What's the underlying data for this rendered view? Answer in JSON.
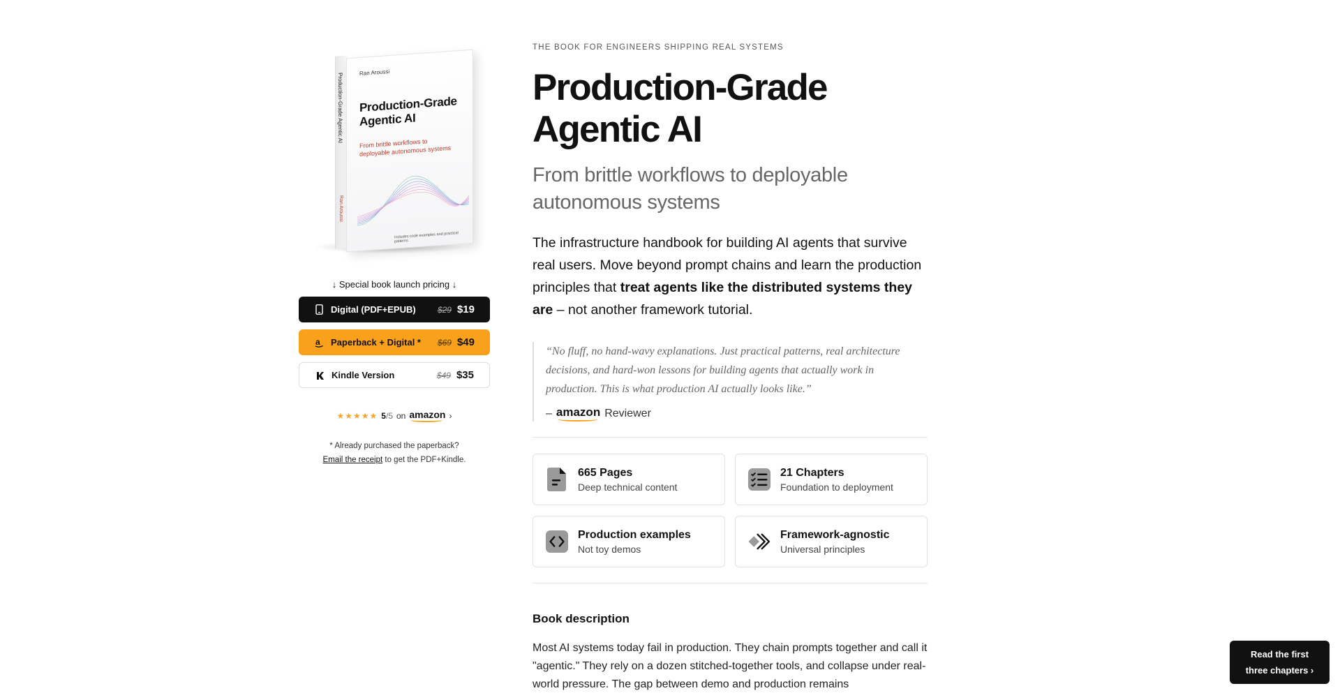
{
  "cover": {
    "author": "Ran Aroussi",
    "title": "Production-Grade Agentic AI",
    "subtitle": "From brittle workflows to deployable autonomous systems",
    "spine_title": "Production-Grade Agentic AI",
    "spine_author": "Ran Aroussi",
    "footer": "Includes code examples and practical patterns"
  },
  "launch_label": "↓ Special book launch pricing ↓",
  "pricing": [
    {
      "label": "Digital (PDF+EPUB)",
      "old": "$29",
      "new": "$19",
      "icon": "phone-icon"
    },
    {
      "label": "Paperback + Digital *",
      "old": "$69",
      "new": "$49",
      "icon": "amazon-icon"
    },
    {
      "label": "Kindle Version",
      "old": "$49",
      "new": "$35",
      "icon": "kindle-icon"
    }
  ],
  "rating": {
    "stars": "★★★★★",
    "score": "5",
    "of": "/5",
    "on": "on",
    "brand": "amazon",
    "chevron": "›"
  },
  "note": {
    "line1": "* Already purchased the paperback?",
    "link": "Email the receipt",
    "line2": " to get the PDF+Kindle."
  },
  "hero": {
    "eyebrow": "THE BOOK FOR ENGINEERS SHIPPING REAL SYSTEMS",
    "title_line1": "Production-Grade",
    "title_line2": "Agentic AI",
    "subtitle": "From brittle workflows to deployable autonomous systems",
    "intro_a": "The infrastructure handbook for building AI agents that survive real users. Move beyond prompt chains and learn the production principles that ",
    "intro_bold": "treat agents like the distributed systems they are",
    "intro_b": " – not another framework tutorial."
  },
  "quote": {
    "text": "“No fluff, no hand-wavy explanations. Just practical patterns, real architecture decisions, and hard-won lessons for building agents that actually work in production. This is what production AI actually looks like.”",
    "dash": "–",
    "brand": "amazon",
    "role": "Reviewer"
  },
  "features": [
    {
      "title": "665 Pages",
      "sub": "Deep technical content",
      "icon": "document-icon"
    },
    {
      "title": "21 Chapters",
      "sub": "Foundation to deployment",
      "icon": "checklist-icon"
    },
    {
      "title": "Production examples",
      "sub": "Not toy demos",
      "icon": "code-icon"
    },
    {
      "title": "Framework-agnostic",
      "sub": "Universal principles",
      "icon": "frameworks-icon"
    }
  ],
  "description": {
    "heading": "Book description",
    "text": "Most AI systems today fail in production. They chain prompts together and call it \"agentic.\" They rely on a dozen stitched-together tools, and collapse under real-world pressure. The gap between demo and production remains"
  },
  "float_button": {
    "line1": "Read the first",
    "line2": "three chapters ›"
  },
  "colors": {
    "accent": "#f9a11b",
    "dark": "#111111",
    "stars": "#f5a623",
    "cover_red": "#c0392b"
  }
}
